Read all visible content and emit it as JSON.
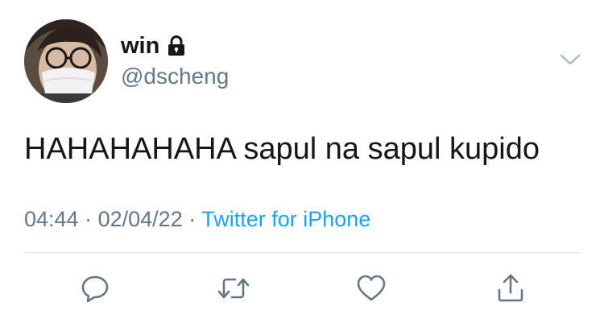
{
  "tweet": {
    "display_name": "win",
    "handle": "@dscheng",
    "text": "HAHAHAHAHA sapul na sapul kupido",
    "time": "04:44",
    "date": "02/04/22",
    "separator": "·",
    "source": "Twitter for iPhone",
    "protected_icon": "lock-icon",
    "more_icon": "chevron-down-icon"
  },
  "actions": [
    {
      "name": "reply",
      "icon": "reply-icon"
    },
    {
      "name": "retweet",
      "icon": "retweet-icon"
    },
    {
      "name": "like",
      "icon": "heart-icon"
    },
    {
      "name": "share",
      "icon": "share-icon"
    }
  ],
  "colors": {
    "text": "#14171a",
    "secondary": "#657786",
    "link": "#1da1f2",
    "divider": "#dfe4e8",
    "icon": "#657786"
  }
}
